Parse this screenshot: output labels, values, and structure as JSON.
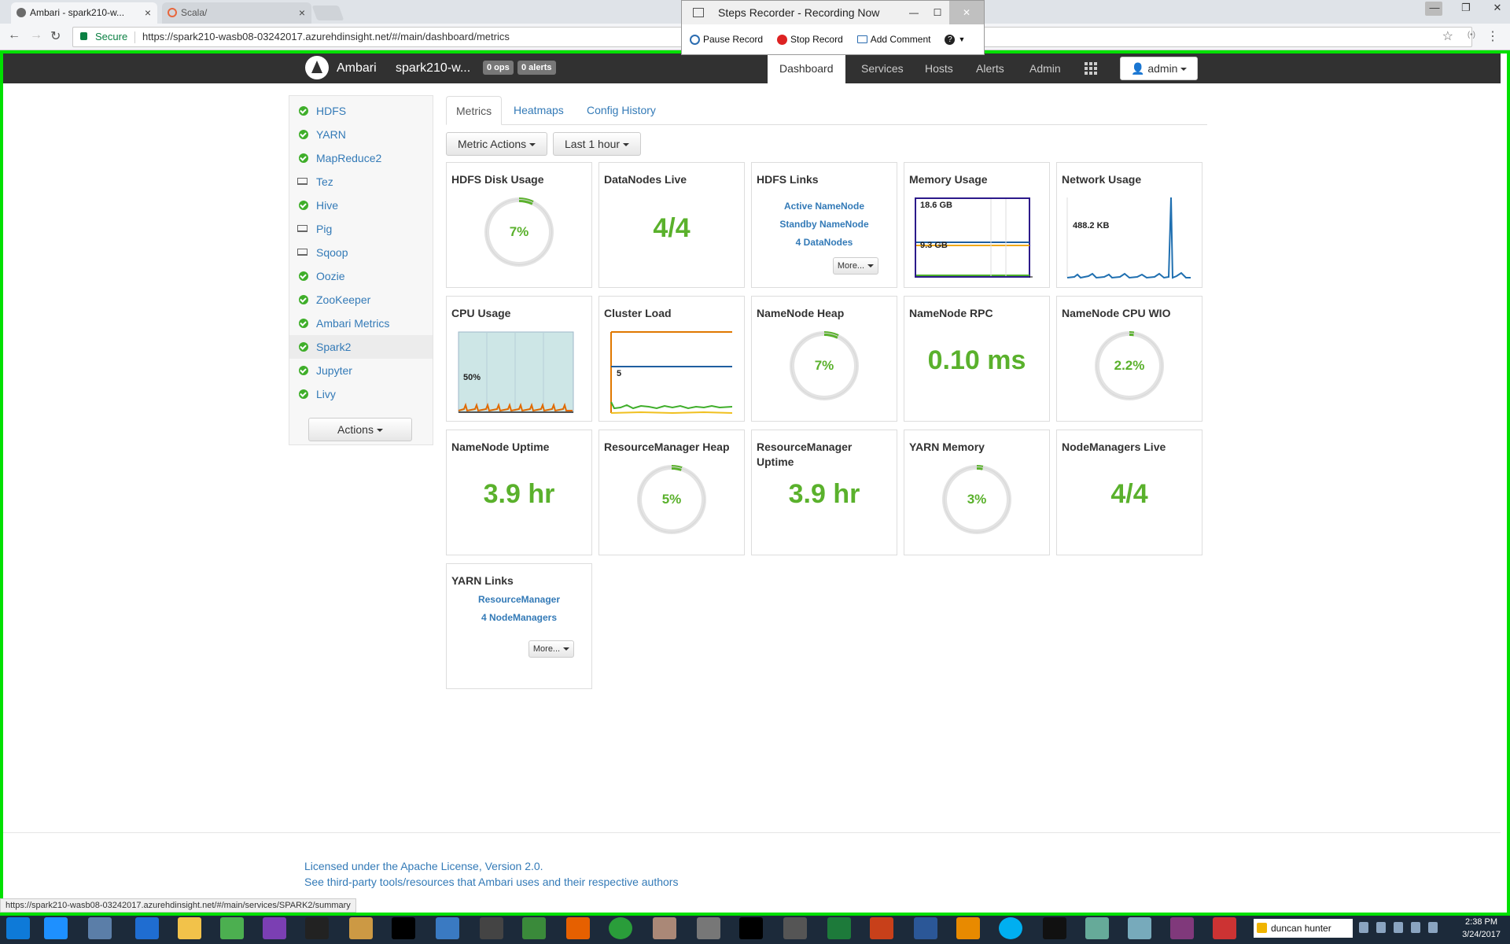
{
  "browser": {
    "tabs": [
      {
        "label": "Ambari - spark210-w...",
        "fav": "#6b6b6b"
      },
      {
        "label": "Scala/",
        "fav": "#e8663c"
      }
    ],
    "secure_label": "Secure",
    "url": "https://spark210-wasb08-03242017.azurehdinsight.net/#/main/dashboard/metrics"
  },
  "recorder": {
    "title": "Steps Recorder - Recording Now",
    "pause": "Pause Record",
    "stop": "Stop Record",
    "comment": "Add Comment"
  },
  "ambari": {
    "brand": "Ambari",
    "cluster": "spark210-w...",
    "ops_badge": "0 ops",
    "alerts_badge": "0 alerts",
    "nav": [
      "Dashboard",
      "Services",
      "Hosts",
      "Alerts",
      "Admin"
    ],
    "user": "admin"
  },
  "services": [
    {
      "name": "HDFS",
      "status": "ok"
    },
    {
      "name": "YARN",
      "status": "ok"
    },
    {
      "name": "MapReduce2",
      "status": "ok"
    },
    {
      "name": "Tez",
      "status": "client"
    },
    {
      "name": "Hive",
      "status": "ok"
    },
    {
      "name": "Pig",
      "status": "client"
    },
    {
      "name": "Sqoop",
      "status": "client"
    },
    {
      "name": "Oozie",
      "status": "ok"
    },
    {
      "name": "ZooKeeper",
      "status": "ok"
    },
    {
      "name": "Ambari Metrics",
      "status": "ok"
    },
    {
      "name": "Spark2",
      "status": "ok"
    },
    {
      "name": "Jupyter",
      "status": "ok"
    },
    {
      "name": "Livy",
      "status": "ok"
    }
  ],
  "sidebar_actions": "Actions",
  "main_tabs": [
    "Metrics",
    "Heatmaps",
    "Config History"
  ],
  "metric_actions": "Metric Actions",
  "time_range": "Last 1 hour",
  "widgets": {
    "hdfs_disk": {
      "title": "HDFS Disk Usage",
      "value": "7%",
      "percent": 7
    },
    "datanodes": {
      "title": "DataNodes Live",
      "value": "4/4"
    },
    "hdfs_links": {
      "title": "HDFS Links",
      "links": [
        "Active NameNode",
        "Standby NameNode",
        "4 DataNodes"
      ],
      "more": "More..."
    },
    "memory": {
      "title": "Memory Usage",
      "label_top": "18.6 GB",
      "label_mid": "9.3 GB"
    },
    "network": {
      "title": "Network Usage",
      "label": "488.2 KB"
    },
    "cpu": {
      "title": "CPU Usage",
      "label": "50%"
    },
    "cluster_load": {
      "title": "Cluster Load",
      "label": "5"
    },
    "nn_heap": {
      "title": "NameNode Heap",
      "value": "7%",
      "percent": 7
    },
    "nn_rpc": {
      "title": "NameNode RPC",
      "value": "0.10 ms"
    },
    "nn_cpu": {
      "title": "NameNode CPU WIO",
      "value": "2.2%",
      "percent": 2.2
    },
    "nn_uptime": {
      "title": "NameNode Uptime",
      "value": "3.9 hr"
    },
    "rm_heap": {
      "title": "ResourceManager Heap",
      "value": "5%",
      "percent": 5
    },
    "rm_uptime": {
      "title": "ResourceManager Uptime",
      "value": "3.9 hr"
    },
    "yarn_memory": {
      "title": "YARN Memory",
      "value": "3%",
      "percent": 3
    },
    "nm_live": {
      "title": "NodeManagers Live",
      "value": "4/4"
    },
    "yarn_links": {
      "title": "YARN Links",
      "links": [
        "ResourceManager",
        "4 NodeManagers"
      ],
      "more": "More..."
    }
  },
  "footer": {
    "license": "Licensed under the Apache License, Version 2.0.",
    "third_party": "See third-party tools/resources that Ambari uses and their respective authors"
  },
  "status_url": "https://spark210-wasb08-03242017.azurehdinsight.net/#/main/services/SPARK2/summary",
  "taskbar": {
    "search_text": "duncan hunter",
    "time": "2:38 PM",
    "date": "3/24/2017"
  },
  "colors": {
    "green": "#5ab12c",
    "link": "#337ab7",
    "frame": "#00e000"
  }
}
